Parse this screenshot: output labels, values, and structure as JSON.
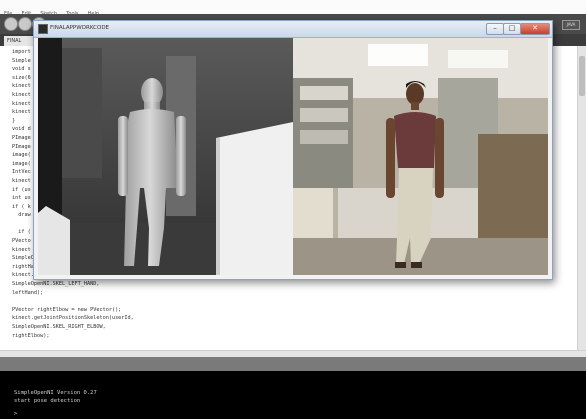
{
  "ide": {
    "menu": [
      "File",
      "Edit",
      "Sketch",
      "Tools",
      "Help"
    ],
    "tab_label": "FINAL",
    "mode_label": "JAVA",
    "code_lines": [
      "import",
      "Simple",
      "void s",
      "size(6",
      "kinect",
      "kinect",
      "kinect",
      "kinect",
      "}",
      "void d",
      "PImage",
      "PImage",
      "image(",
      "image(",
      "IntVec",
      "kinect",
      "if (us",
      "int us",
      "if ( k",
      "  draw",
      "",
      "  if (",
      "PVecto",
      "kinect",
      "SimpleOpenNI.",
      "rightHand);",
      "kinect.getJointPositionSkeleton(userId,",
      "SimpleOpenNI.SKEL_LEFT_HAND,",
      "leftHand);",
      "",
      "PVector rightElbow = new PVector();",
      "kinect.getJointPositionSkeleton(userId,",
      "SimpleOpenNI.SKEL_RIGHT_ELBOW,",
      "rightElbow);"
    ],
    "console_lines": [
      "SimpleOpenNI Version 0.27",
      "start pose detection",
      ">"
    ]
  },
  "sketch": {
    "title": "FINALAPPWORKCODE",
    "buttons": {
      "minimize": "–",
      "maximize": "□",
      "close": "✕"
    }
  }
}
